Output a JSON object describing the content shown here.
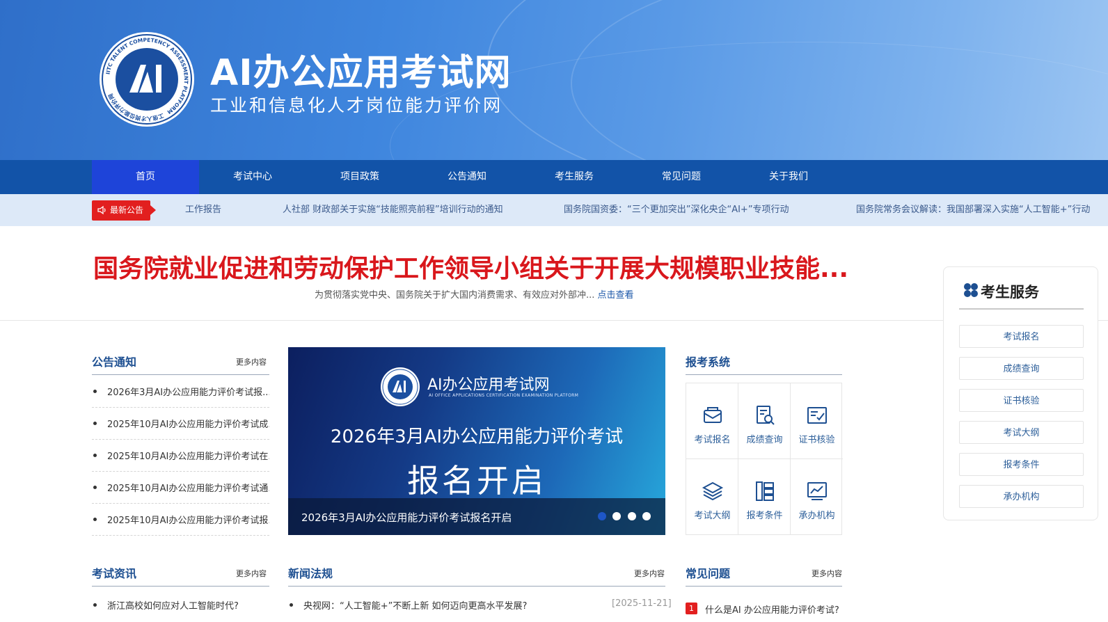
{
  "header": {
    "title": "AI办公应用考试网",
    "subtitle": "工业和信息化人才岗位能力评价网",
    "logo_ring_text": "IITC TALENT COMPETENCY ASSESSMENT PLATFORM",
    "logo_ring_text_cn": "工信人才岗位能力评价网",
    "colors": {
      "primary": "#1253a8",
      "active": "#1e44d9",
      "accent": "#e21f1f"
    }
  },
  "nav": {
    "items": [
      {
        "label": "首页"
      },
      {
        "label": "考试中心"
      },
      {
        "label": "项目政策"
      },
      {
        "label": "公告通知"
      },
      {
        "label": "考生服务"
      },
      {
        "label": "常见问题"
      },
      {
        "label": "关于我们"
      }
    ]
  },
  "notice": {
    "badge": "最新公告",
    "items": [
      "工作报告",
      "人社部 财政部关于实施“技能照亮前程”培训行动的通知",
      "国务院国资委：“三个更加突出”深化央企“AI+”专项行动",
      "国务院常务会议解读：我国部署深入实施“人工智能+”行动"
    ]
  },
  "headline": {
    "title": "国务院就业促进和劳动保护工作领导小组关于开展大规模职业技能...",
    "summary": "为贯彻落实党中央、国务院关于扩大国内消费需求、有效应对外部冲...",
    "more": "点击查看"
  },
  "announcements": {
    "title": "公告通知",
    "more": "更多内容",
    "items": [
      "2026年3月AI办公应用能力评价考试报...",
      "2025年10月AI办公应用能力评价考试成...",
      "2025年10月AI办公应用能力评价考试在...",
      "2025年10月AI办公应用能力评价考试通...",
      "2025年10月AI办公应用能力评价考试报..."
    ]
  },
  "banner": {
    "brand": "AI办公应用考试网",
    "brand_en": "AI OFFICE APPLICATIONS CERTIFICATION EXAMINATION PLATFORM",
    "line1": "2026年3月AI办公应用能力评价考试",
    "line2": "报名开启",
    "caption": "2026年3月AI办公应用能力评价考试报名开启",
    "slide_count": 4,
    "active_slide": 1
  },
  "reg_system": {
    "title": "报考系统",
    "items": [
      {
        "label": "考试报名",
        "icon": "envelope-icon"
      },
      {
        "label": "成绩查询",
        "icon": "search-doc-icon"
      },
      {
        "label": "证书核验",
        "icon": "certificate-icon"
      },
      {
        "label": "考试大纲",
        "icon": "layers-icon"
      },
      {
        "label": "报考条件",
        "icon": "list-icon"
      },
      {
        "label": "承办机构",
        "icon": "chart-icon"
      }
    ]
  },
  "side_service": {
    "title": "考生服务",
    "buttons": [
      "考试报名",
      "成绩查询",
      "证书核验",
      "考试大纲",
      "报考条件",
      "承办机构"
    ]
  },
  "exam_news": {
    "title": "考试资讯",
    "more": "更多内容",
    "items": [
      "浙江高校如何应对人工智能时代?"
    ]
  },
  "news_laws": {
    "title": "新闻法规",
    "more": "更多内容",
    "items": [
      {
        "text": "央视网：“人工智能+”不断上新 如何迈向更高水平发展?",
        "date": "[2025-11-21]"
      }
    ]
  },
  "faq": {
    "title": "常见问题",
    "more": "更多内容",
    "items": [
      {
        "num": "1",
        "text": "什么是AI 办公应用能力评价考试?"
      }
    ]
  }
}
